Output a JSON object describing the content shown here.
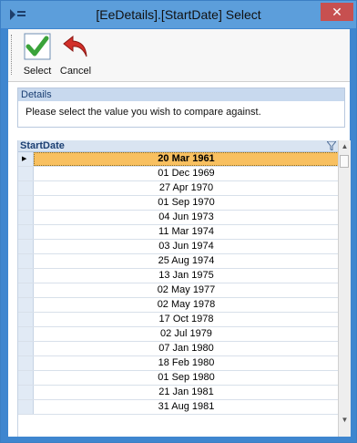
{
  "window": {
    "title": "[EeDetails].[StartDate] Select",
    "close_glyph": "✕"
  },
  "toolbar": {
    "select_label": "Select",
    "cancel_label": "Cancel"
  },
  "details": {
    "header": "Details",
    "text": "Please select the value you wish to compare against."
  },
  "grid": {
    "column_header": "StartDate",
    "rows": [
      "20 Mar 1961",
      "01 Dec 1969",
      "27 Apr 1970",
      "01 Sep 1970",
      "04 Jun 1973",
      "11 Mar 1974",
      "03 Jun 1974",
      "25 Aug 1974",
      "13 Jan 1975",
      "02 May 1977",
      "02 May 1978",
      "17 Oct 1978",
      "02 Jul 1979",
      "07 Jan 1980",
      "18 Feb 1980",
      "01 Sep 1980",
      "21 Jan 1981",
      "31 Aug 1981"
    ],
    "current_row": "20 Mar 1961"
  },
  "colors": {
    "titlebar": "#5c9edb",
    "close": "#c75050",
    "selected_row": "#f8c060"
  },
  "icons": [
    "app-icon",
    "checkmark-icon",
    "undo-arrow-icon",
    "filter-icon",
    "scroll-up-icon",
    "scroll-down-icon"
  ]
}
